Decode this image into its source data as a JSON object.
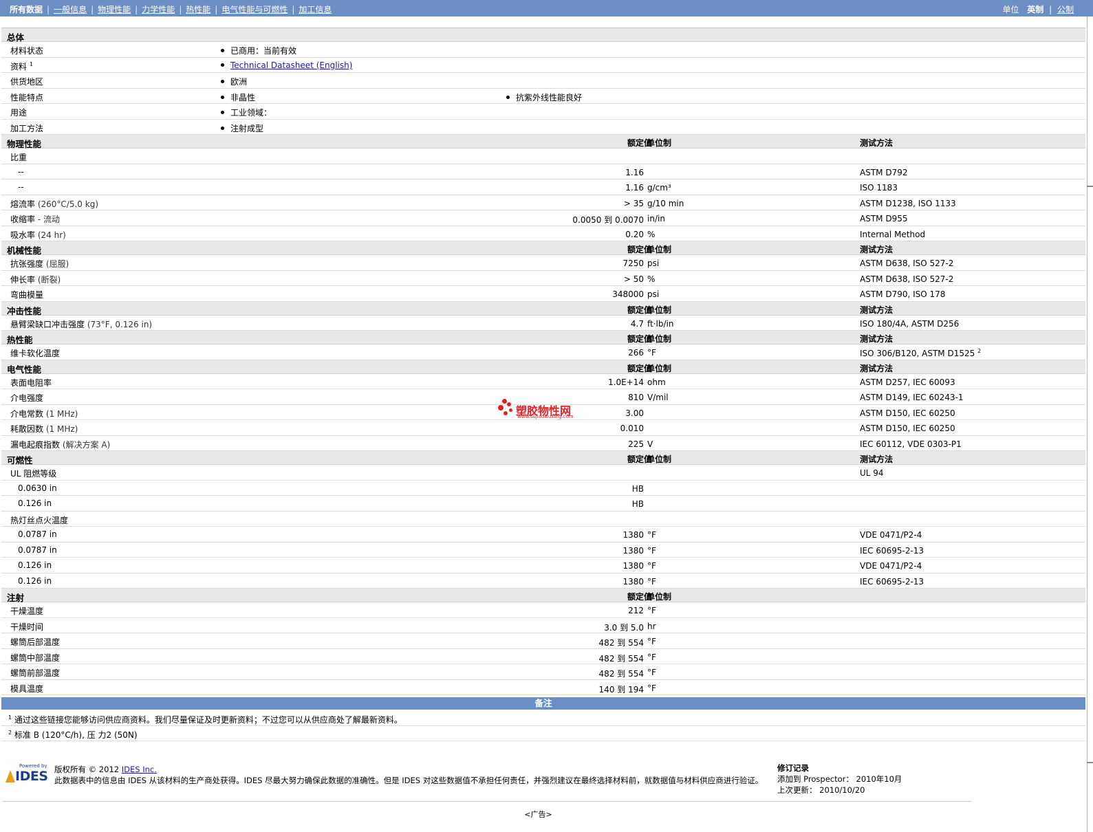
{
  "nav": {
    "items": [
      "所有数据",
      "一般信息",
      "物理性能",
      "力学性能",
      "热性能",
      "电气性能与可燃性",
      "加工信息"
    ],
    "units_label": "单位",
    "units_current": "英制",
    "units_other": "公制"
  },
  "columns": {
    "value": "额定值",
    "unit": "单位制",
    "method": "测试方法"
  },
  "general": {
    "title": "总体",
    "rows": [
      {
        "label": "材料状态",
        "items": [
          "已商用：当前有效"
        ]
      },
      {
        "label": "资料",
        "sup": "1",
        "items": [
          "Technical Datasheet (English)"
        ]
      },
      {
        "label": "供货地区",
        "items": [
          "欧洲"
        ]
      },
      {
        "label": "性能特点",
        "items": [
          "非晶性",
          "抗紫外线性能良好"
        ]
      },
      {
        "label": "用途",
        "items": [
          "工业领域："
        ]
      },
      {
        "label": "加工方法",
        "items": [
          "注射成型"
        ]
      }
    ]
  },
  "physical": {
    "title": "物理性能",
    "rows": [
      {
        "label": "比重",
        "value": "",
        "unit": "",
        "method": ""
      },
      {
        "label": "--",
        "sub": true,
        "value": "1.16",
        "unit": "",
        "method": "ASTM D792"
      },
      {
        "label": "--",
        "sub": true,
        "value": "1.16",
        "unit": "g/cm³",
        "method": "ISO 1183"
      },
      {
        "label": "熔流率",
        "mod": "(260°C/5.0 kg)",
        "value": "> 35",
        "unit": "g/10 min",
        "method": "ASTM D1238, ISO 1133"
      },
      {
        "label": "收缩率",
        "mod": "- 流动",
        "value": "0.0050 到  0.0070",
        "unit": "in/in",
        "method": "ASTM D955"
      },
      {
        "label": "吸水率",
        "mod": "(24 hr)",
        "value": "0.20",
        "unit": "%",
        "method": "Internal Method"
      }
    ]
  },
  "mechanical": {
    "title": "机械性能",
    "rows": [
      {
        "label": "抗张强度",
        "mod": "(屈服)",
        "value": "7250",
        "unit": "psi",
        "method": "ASTM D638, ISO 527-2"
      },
      {
        "label": "伸长率",
        "mod": "(断裂)",
        "value": "> 50",
        "unit": "%",
        "method": "ASTM D638, ISO 527-2"
      },
      {
        "label": "弯曲模量",
        "value": "348000",
        "unit": "psi",
        "method": "ASTM D790, ISO 178"
      }
    ]
  },
  "impact": {
    "title": "冲击性能",
    "rows": [
      {
        "label": "悬臂梁缺口冲击强度",
        "mod": "(73°F, 0.126 in)",
        "value": "4.7",
        "unit": "ft·lb/in",
        "method": "ISO 180/4A, ASTM D256"
      }
    ]
  },
  "thermal": {
    "title": "热性能",
    "rows": [
      {
        "label": "维卡软化温度",
        "value": "266",
        "unit": "°F",
        "method": "ISO 306/B120, ASTM D1525",
        "method_sup": "2"
      }
    ]
  },
  "electrical": {
    "title": "电气性能",
    "rows": [
      {
        "label": "表面电阻率",
        "value": "1.0E+14",
        "unit": "ohm",
        "method": "ASTM D257, IEC 60093"
      },
      {
        "label": "介电强度",
        "value": "810",
        "unit": "V/mil",
        "method": "ASTM D149, IEC 60243-1"
      },
      {
        "label": "介电常数",
        "mod": "(1 MHz)",
        "value": "3.00",
        "unit": "",
        "method": "ASTM D150, IEC 60250"
      },
      {
        "label": "耗散因数",
        "mod": "(1 MHz)",
        "value": "0.010",
        "unit": "",
        "method": "ASTM D150, IEC 60250"
      },
      {
        "label": "漏电起痕指数",
        "mod": "(解决方案  A)",
        "value": "225",
        "unit": "V",
        "method": "IEC 60112, VDE 0303-P1"
      }
    ]
  },
  "flammability": {
    "title": "可燃性",
    "rows": [
      {
        "label": "UL 阻燃等级",
        "value": "",
        "unit": "",
        "method": "UL 94"
      },
      {
        "label": "0.0630 in",
        "sub": true,
        "value": "HB",
        "unit": "",
        "method": ""
      },
      {
        "label": "0.126 in",
        "sub": true,
        "value": "HB",
        "unit": "",
        "method": ""
      },
      {
        "label": "热灯丝点火温度",
        "value": "",
        "unit": "",
        "method": ""
      },
      {
        "label": "0.0787 in",
        "sub": true,
        "value": "1380",
        "unit": "°F",
        "method": "VDE 0471/P2-4"
      },
      {
        "label": "0.0787 in",
        "sub": true,
        "value": "1380",
        "unit": "°F",
        "method": "IEC 60695-2-13"
      },
      {
        "label": "0.126 in",
        "sub": true,
        "value": "1380",
        "unit": "°F",
        "method": "VDE 0471/P2-4"
      },
      {
        "label": "0.126 in",
        "sub": true,
        "value": "1380",
        "unit": "°F",
        "method": "IEC 60695-2-13"
      }
    ]
  },
  "injection": {
    "title": "注射",
    "rows": [
      {
        "label": "干燥温度",
        "value": "212",
        "unit": "°F",
        "method": ""
      },
      {
        "label": "干燥时间",
        "value": "3.0 到  5.0",
        "unit": "hr",
        "method": ""
      },
      {
        "label": "螺筒后部温度",
        "value": "482 到  554",
        "unit": "°F",
        "method": ""
      },
      {
        "label": "螺筒中部温度",
        "value": "482 到  554",
        "unit": "°F",
        "method": ""
      },
      {
        "label": "螺筒前部温度",
        "value": "482 到  554",
        "unit": "°F",
        "method": ""
      },
      {
        "label": "模具温度",
        "value": "140 到  194",
        "unit": "°F",
        "method": ""
      }
    ]
  },
  "notes": {
    "title": "备注",
    "items": [
      {
        "num": "1",
        "text": "通过这些链接您能够访问供应商资料。我们尽量保证及时更新资料；不过您可以从供应商处了解最新资料。"
      },
      {
        "num": "2",
        "text": "标准  B (120°C/h), 压  力2 (50N)"
      }
    ]
  },
  "footer": {
    "logo_powered": "Powered by",
    "logo_name": "IDES",
    "copyright": "版权所有  © 2012",
    "copyright_link": "IDES Inc.",
    "disclaimer": "此数据表中的信息由  IDES 从该材料的生产商处获得。IDES 尽最大努力确保此数据的准确性。但是  IDES 对这些数据值不承担任何责任，并强烈建议在最终选择材料前，就数据值与材料供应商进行验证。",
    "revision_title": "修订记录",
    "added_label": "添加到  Prospector：",
    "added_value": "2010年10月",
    "updated_label": "上次更新：",
    "updated_value": "2010/10/20",
    "ad": "<广告>"
  },
  "watermark": {
    "text": "塑胶物性网",
    "url": "www.sujiaowuxing.com",
    "color": "#e31e24"
  },
  "colors": {
    "header_bar": "#6b8fc5",
    "section_bg": "#e8e8e8",
    "link": "#1a1aa6"
  }
}
